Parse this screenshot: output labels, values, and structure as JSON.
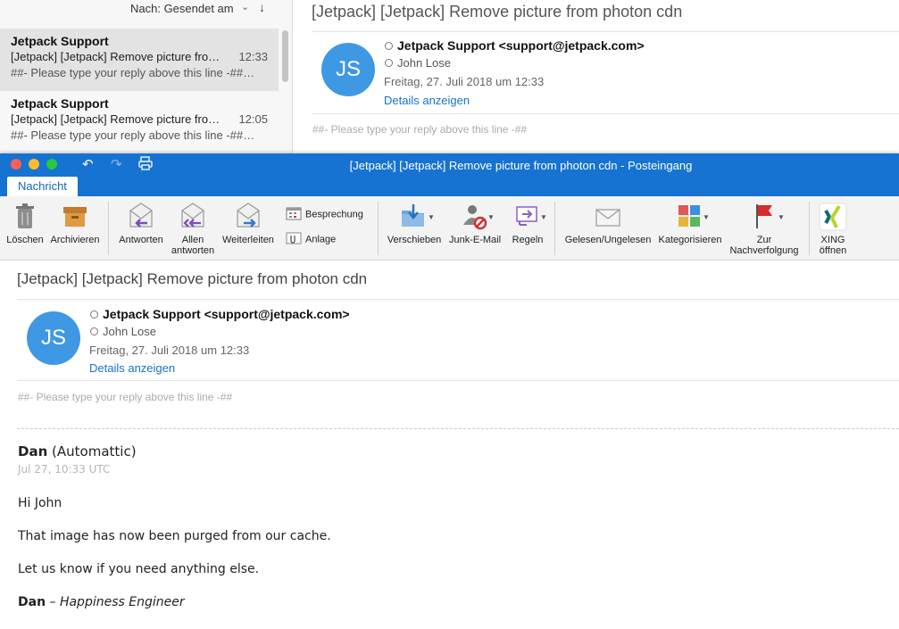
{
  "background_window": {
    "sort": {
      "label": "Nach: Gesendet am",
      "chevron": "⌄",
      "direction": "↓"
    },
    "list": [
      {
        "sender": "Jetpack Support",
        "subject": "[Jetpack] [Jetpack] Remove picture fro…",
        "time": "12:33",
        "preview": "##- Please type your reply above this line -##…"
      },
      {
        "sender": "Jetpack Support",
        "subject": "[Jetpack] [Jetpack] Remove picture fro…",
        "time": "12:05",
        "preview": "##- Please type your reply above this line -##…"
      }
    ],
    "reader": {
      "subject": "[Jetpack] [Jetpack] Remove picture from photon cdn",
      "avatar_initials": "JS",
      "from": "Jetpack Support <support@jetpack.com>",
      "to": "John Lose",
      "date": "Freitag, 27. Juli 2018 um 12:33",
      "details": "Details anzeigen",
      "reply_line": "##- Please type your reply above this line -##"
    }
  },
  "window": {
    "title": "[Jetpack] [Jetpack] Remove picture from photon cdn - Posteingang",
    "tab": "Nachricht"
  },
  "ribbon": {
    "delete": "Löschen",
    "archive": "Archivieren",
    "reply": "Antworten",
    "reply_all_1": "Allen",
    "reply_all_2": "antworten",
    "forward": "Weiterleiten",
    "meeting": "Besprechung",
    "attachment": "Anlage",
    "move": "Verschieben",
    "junk": "Junk-E-Mail",
    "rules": "Regeln",
    "read_unread": "Gelesen/Ungelesen",
    "categorize": "Kategorisieren",
    "followup_1": "Zur",
    "followup_2": "Nachverfolgung",
    "xing_1": "XING",
    "xing_2": "öffnen"
  },
  "message": {
    "subject": "[Jetpack] [Jetpack] Remove picture from photon cdn",
    "avatar_initials": "JS",
    "from": "Jetpack Support <support@jetpack.com>",
    "to": "John Lose",
    "date": "Freitag, 27. Juli 2018 um 12:33",
    "details": "Details anzeigen",
    "reply_line": "##- Please type your reply above this line -##",
    "author_name": "Dan",
    "author_org": "(Automattic)",
    "timestamp": "Jul 27, 10:33 UTC",
    "greeting": "Hi John",
    "line1": "That image has now been purged from our cache.",
    "line2": "Let us know if you need anything else.",
    "sig_name": "Dan",
    "sig_sep": "–",
    "sig_role": "Happiness Engineer"
  },
  "colors": {
    "accent": "#1673d1",
    "avatar": "#3e98e4",
    "link": "#1a6fc9"
  }
}
